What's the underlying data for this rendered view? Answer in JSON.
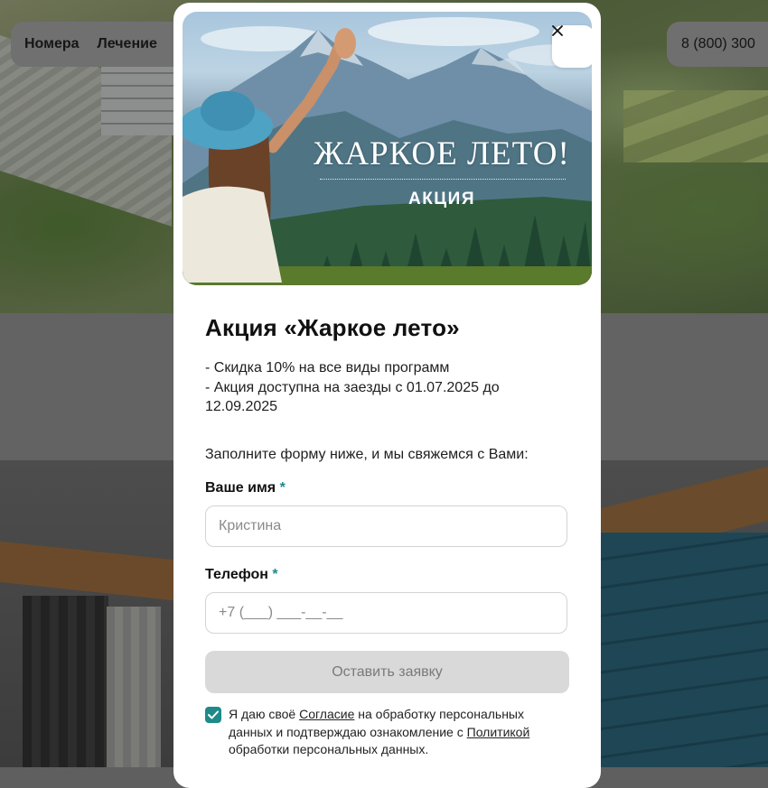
{
  "background": {
    "nav_items": [
      "Номера",
      "Лечение"
    ],
    "phone": "8 (800) 300"
  },
  "modal": {
    "banner": {
      "title": "ЖАРКОЕ ЛЕТО!",
      "subtitle": "АКЦИЯ"
    },
    "close_icon": "close-icon",
    "heading": "Акция «Жаркое лето»",
    "description_lines": [
      "- Скидка 10% на все виды программ",
      "- Акция доступна на заезды с 01.07.2025 до\n12.09.2025"
    ],
    "lead": "Заполните форму ниже, и мы свяжемся с Вами:",
    "form": {
      "name_label": "Ваше имя",
      "phone_label": "Телефон",
      "required_mark": "*",
      "name_placeholder": "Кристина",
      "phone_placeholder": "+7 (___) ___-__-__",
      "submit_label": "Оставить заявку"
    },
    "consent": {
      "checked": true,
      "text_1": "Я даю своё ",
      "link_1": "Согласие",
      "text_2": " на обработку персональных данных и подтверждаю ознакомление с ",
      "link_2": "Политикой",
      "text_3": " обработки персональных данных."
    }
  },
  "colors": {
    "accent": "#1f8a8a",
    "submit_disabled_bg": "#d9d9d9",
    "overlay_bg": "#5f5f5f"
  }
}
